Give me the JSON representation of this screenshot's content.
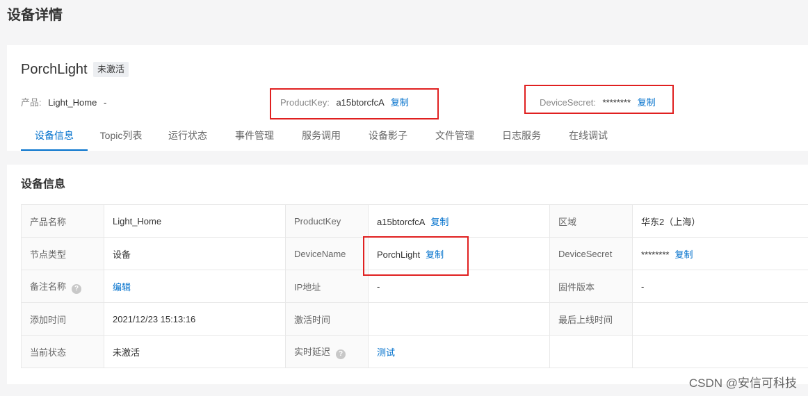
{
  "page": {
    "title": "设备详情"
  },
  "header": {
    "device_name": "PorchLight",
    "status": "未激活",
    "product_label": "产品:",
    "product_value": "Light_Home",
    "product_extra": "-",
    "product_key_label": "ProductKey:",
    "product_key_value": "a15btorcfcA",
    "device_secret_label": "DeviceSecret:",
    "device_secret_value": "********",
    "copy_label": "复制"
  },
  "tabs": [
    {
      "label": "设备信息",
      "active": true
    },
    {
      "label": "Topic列表"
    },
    {
      "label": "运行状态"
    },
    {
      "label": "事件管理"
    },
    {
      "label": "服务调用"
    },
    {
      "label": "设备影子"
    },
    {
      "label": "文件管理"
    },
    {
      "label": "日志服务"
    },
    {
      "label": "在线调试"
    }
  ],
  "info": {
    "section_title": "设备信息",
    "rows": [
      [
        {
          "k": "产品名称",
          "v": "Light_Home"
        },
        {
          "k": "ProductKey",
          "v": "a15btorcfcA",
          "link": "复制"
        },
        {
          "k": "区域",
          "v": "华东2（上海）"
        }
      ],
      [
        {
          "k": "节点类型",
          "v": "设备"
        },
        {
          "k": "DeviceName",
          "v": "PorchLight",
          "link": "复制"
        },
        {
          "k": "DeviceSecret",
          "v": "********",
          "link": "复制"
        }
      ],
      [
        {
          "k": "备注名称",
          "help": "?",
          "link": "编辑"
        },
        {
          "k": "IP地址",
          "v": "-"
        },
        {
          "k": "固件版本",
          "v": "-"
        }
      ],
      [
        {
          "k": "添加时间",
          "v": "2021/12/23 15:13:16"
        },
        {
          "k": "激活时间",
          "v": ""
        },
        {
          "k": "最后上线时间",
          "v": ""
        }
      ],
      [
        {
          "k": "当前状态",
          "v": "未激活"
        },
        {
          "k": "实时延迟",
          "help": "?",
          "link": "测试"
        },
        {
          "k": "",
          "v": ""
        }
      ]
    ]
  },
  "watermark": "CSDN @安信可科技"
}
